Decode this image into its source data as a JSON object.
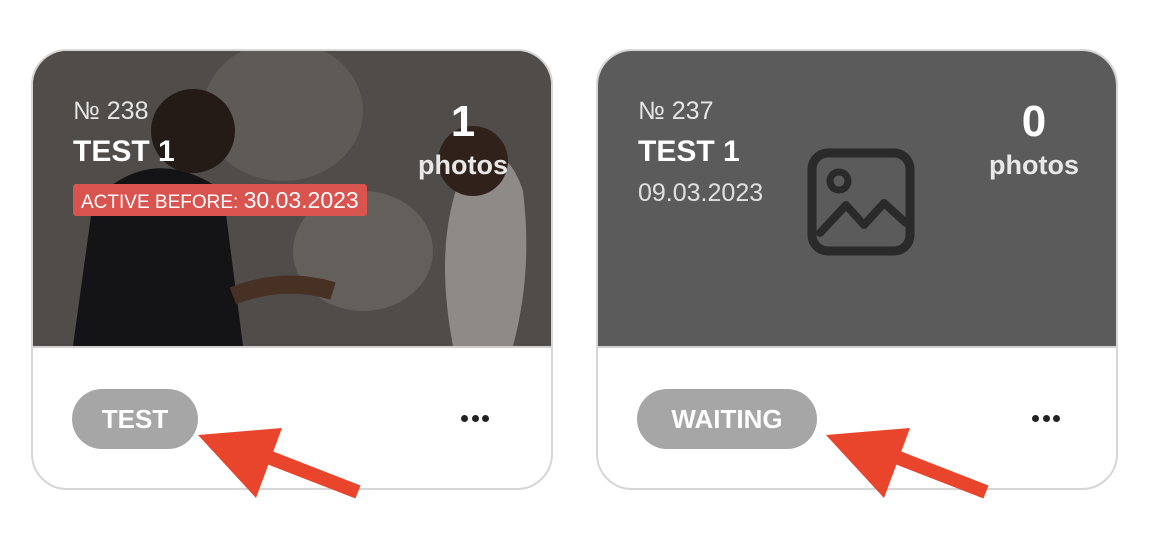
{
  "cards": [
    {
      "number": "№ 238",
      "title": "TEST 1",
      "active_before_label": "ACTIVE BEFORE:",
      "active_before_date": "30.03.2023",
      "photo_count": "1",
      "photo_label": "photos",
      "status": "TEST",
      "cover": "wedding-photo"
    },
    {
      "number": "№ 237",
      "title": "TEST 1",
      "date": "09.03.2023",
      "photo_count": "0",
      "photo_label": "photos",
      "status": "WAITING",
      "cover": "image-placeholder-icon"
    }
  ],
  "colors": {
    "badge_red": "#d9534f",
    "pill_gray": "#a6a6a6",
    "cover_gray": "#5b5b5b",
    "annotation_arrow": "#e8452c"
  }
}
